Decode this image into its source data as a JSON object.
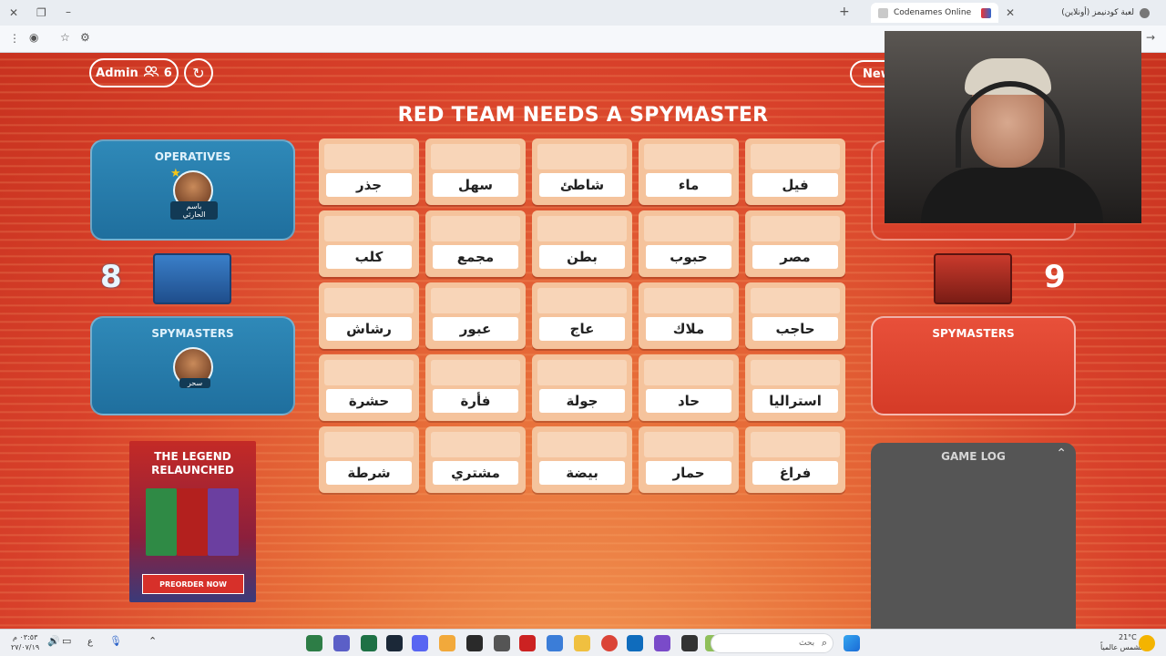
{
  "browser": {
    "tabs": [
      {
        "title": "لعبة كودنيمز (أونلاين)",
        "active": false
      },
      {
        "title": "Codenames Online",
        "active": true
      }
    ],
    "new_tab_symbol": "+"
  },
  "header": {
    "admin_label": "Admin",
    "players_count": "6",
    "new_button_partial": "New",
    "headline": "RED TEAM NEEDS A SPYMASTER"
  },
  "blue_team": {
    "score": "8",
    "operatives_title": "OPERATIVES",
    "operative_name": "باسم الحارثي",
    "spymasters_title": "SPYMASTERS",
    "spymaster_name": "سحر"
  },
  "red_team": {
    "score": "9",
    "spymasters_title": "SPYMASTERS"
  },
  "board": {
    "words": [
      [
        "جذر",
        "سهل",
        "شاطئ",
        "ماء",
        "فيل"
      ],
      [
        "كلب",
        "مجمع",
        "بطن",
        "حبوب",
        "مصر"
      ],
      [
        "رشاش",
        "عبور",
        "عاج",
        "ملاك",
        "حاجب"
      ],
      [
        "حشرة",
        "فأرة",
        "جولة",
        "حاد",
        "استراليا"
      ],
      [
        "شرطة",
        "مشتري",
        "بيضة",
        "حمار",
        "فراغ"
      ]
    ]
  },
  "ad": {
    "title_line1": "THE LEGEND",
    "title_line2": "RELAUNCHED",
    "button": "PREORDER NOW"
  },
  "game_log": {
    "title": "GAME LOG"
  },
  "taskbar": {
    "search_placeholder": "بحث",
    "time": "٠٣:٥٣ م",
    "date": "٢٧/٠٧/١٩",
    "weather_temp": "21°C",
    "weather_desc": "مشمس عالمياً",
    "lang": "ع"
  },
  "colors": {
    "blue_panel": "#2f89b8",
    "red_panel": "#e8503a",
    "card_bg": "#f5c39c",
    "background_red": "#d8402a"
  }
}
